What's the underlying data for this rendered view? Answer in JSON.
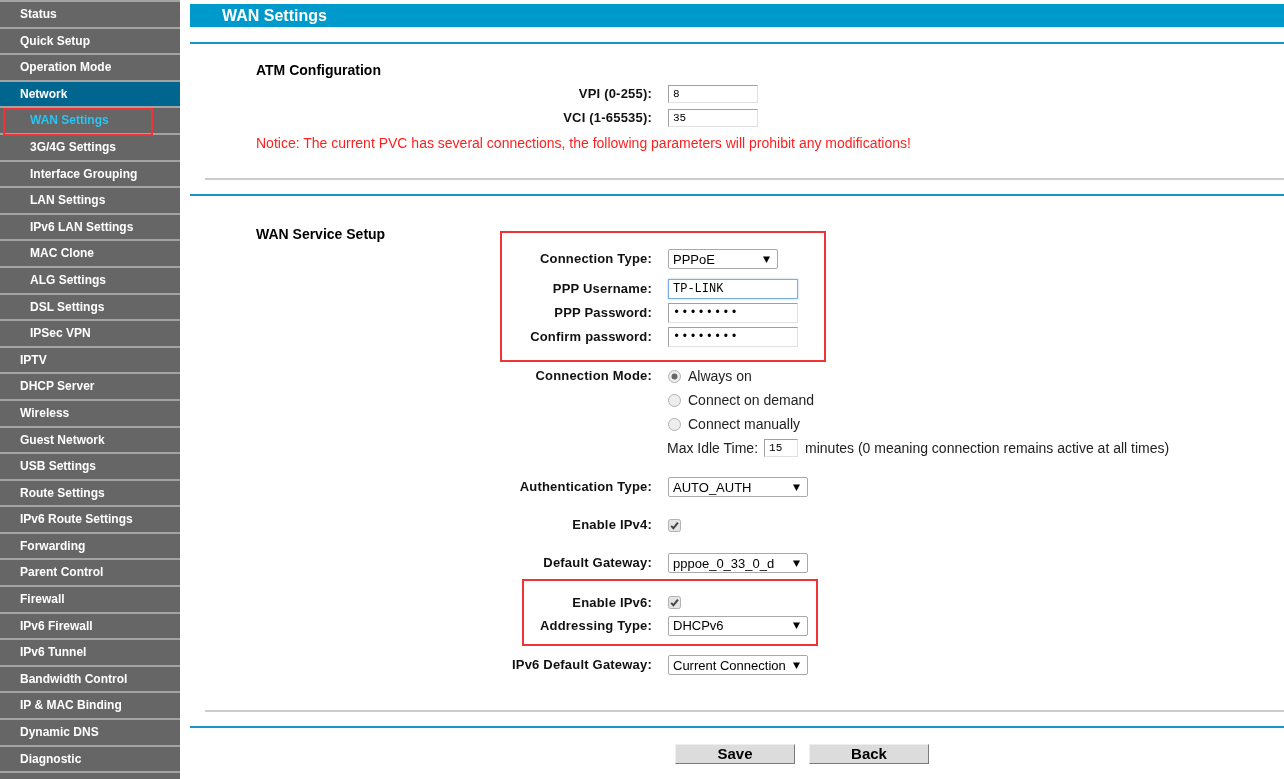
{
  "sidebar": {
    "items": [
      {
        "label": "Status",
        "selected": false,
        "highlighted": false
      },
      {
        "label": "Quick Setup",
        "selected": false,
        "highlighted": false
      },
      {
        "label": "Operation Mode",
        "selected": false,
        "highlighted": false
      },
      {
        "label": "Network",
        "selected": true,
        "highlighted": false,
        "children": [
          {
            "label": "WAN Settings",
            "selected": true,
            "highlighted": true
          },
          {
            "label": "3G/4G Settings",
            "selected": false,
            "highlighted": false
          },
          {
            "label": "Interface Grouping",
            "selected": false,
            "highlighted": false
          },
          {
            "label": "LAN Settings",
            "selected": false,
            "highlighted": false
          },
          {
            "label": "IPv6 LAN Settings",
            "selected": false,
            "highlighted": false
          },
          {
            "label": "MAC Clone",
            "selected": false,
            "highlighted": false
          },
          {
            "label": "ALG Settings",
            "selected": false,
            "highlighted": false
          },
          {
            "label": "DSL Settings",
            "selected": false,
            "highlighted": false
          },
          {
            "label": "IPSec VPN",
            "selected": false,
            "highlighted": false
          }
        ]
      },
      {
        "label": "IPTV",
        "selected": false,
        "highlighted": false
      },
      {
        "label": "DHCP Server",
        "selected": false,
        "highlighted": false
      },
      {
        "label": "Wireless",
        "selected": false,
        "highlighted": false
      },
      {
        "label": "Guest Network",
        "selected": false,
        "highlighted": false
      },
      {
        "label": "USB Settings",
        "selected": false,
        "highlighted": false
      },
      {
        "label": "Route Settings",
        "selected": false,
        "highlighted": false
      },
      {
        "label": "IPv6 Route Settings",
        "selected": false,
        "highlighted": false
      },
      {
        "label": "Forwarding",
        "selected": false,
        "highlighted": false
      },
      {
        "label": "Parent Control",
        "selected": false,
        "highlighted": false
      },
      {
        "label": "Firewall",
        "selected": false,
        "highlighted": false
      },
      {
        "label": "IPv6 Firewall",
        "selected": false,
        "highlighted": false
      },
      {
        "label": "IPv6 Tunnel",
        "selected": false,
        "highlighted": false
      },
      {
        "label": "Bandwidth Control",
        "selected": false,
        "highlighted": false
      },
      {
        "label": "IP & MAC Binding",
        "selected": false,
        "highlighted": false
      },
      {
        "label": "Dynamic DNS",
        "selected": false,
        "highlighted": false
      },
      {
        "label": "Diagnostic",
        "selected": false,
        "highlighted": false
      }
    ]
  },
  "page": {
    "title": "WAN Settings"
  },
  "atm": {
    "title": "ATM Configuration",
    "fields": [
      {
        "label": "VPI (0-255):",
        "value": "8"
      },
      {
        "label": "VCI (1-65535):",
        "value": "35"
      }
    ],
    "notice": "Notice: The current PVC has several connections, the following parameters will prohibit any modifications!"
  },
  "wan_service": {
    "title": "WAN Service Setup",
    "groups": [
      {
        "highlighted": true,
        "rows": [
          {
            "kind": "select",
            "label": "Connection Type:",
            "value": "PPPoE"
          },
          {
            "kind": "text",
            "label": "PPP Username:",
            "value": "TP-LINK",
            "focused": true
          },
          {
            "kind": "password",
            "label": "PPP Password:",
            "value": "••••••••",
            "focused": false
          },
          {
            "kind": "password",
            "label": "Confirm password:",
            "value": "••••••••",
            "focused": false
          }
        ]
      },
      {
        "highlighted": false,
        "rows": [
          {
            "kind": "radio",
            "label": "Connection Mode:",
            "options": [
              {
                "label": "Always on",
                "selected": true
              },
              {
                "label": "Connect on demand",
                "selected": false
              },
              {
                "label": "Connect manually",
                "selected": false
              }
            ]
          },
          {
            "kind": "idle",
            "label": "Max Idle Time:",
            "value": "15",
            "note": "minutes (0 meaning connection remains active at all times)"
          },
          {
            "kind": "select",
            "label": "Authentication Type:",
            "value": "AUTO_AUTH"
          },
          {
            "kind": "checkbox",
            "label": "Enable IPv4:",
            "checked": true
          },
          {
            "kind": "select",
            "label": "Default Gateway:",
            "value": "pppoe_0_33_0_d"
          }
        ]
      },
      {
        "highlighted": true,
        "rows": [
          {
            "kind": "checkbox",
            "label": "Enable IPv6:",
            "checked": true
          },
          {
            "kind": "select",
            "label": "Addressing Type:",
            "value": "DHCPv6"
          }
        ]
      },
      {
        "highlighted": false,
        "rows": [
          {
            "kind": "select",
            "label": "IPv6 Default Gateway:",
            "value": "Current Connection"
          }
        ]
      }
    ]
  },
  "buttons": [
    "Save",
    "Back"
  ]
}
